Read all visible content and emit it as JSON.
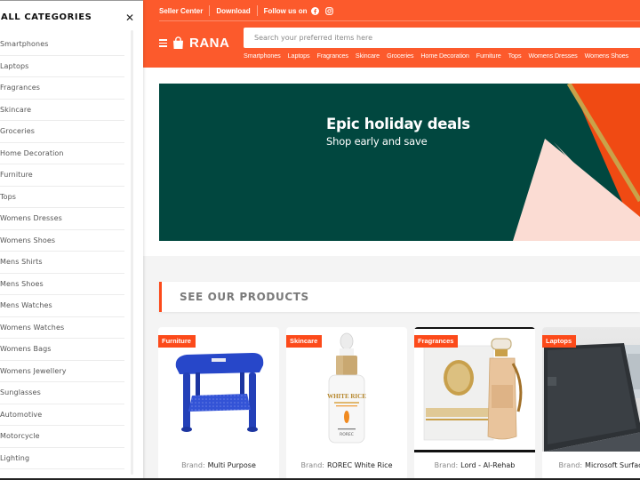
{
  "sidebar": {
    "title": "ALL CATEGORIES",
    "close_icon": "close-icon",
    "categories": [
      "Smartphones",
      "Laptops",
      "Fragrances",
      "Skincare",
      "Groceries",
      "Home Decoration",
      "Furniture",
      "Tops",
      "Womens Dresses",
      "Womens Shoes",
      "Mens Shirts",
      "Mens Shoes",
      "Mens Watches",
      "Womens Watches",
      "Womens Bags",
      "Womens Jewellery",
      "Sunglasses",
      "Automotive",
      "Motorcycle",
      "Lighting"
    ]
  },
  "header": {
    "topbar": {
      "seller_center": "Seller Center",
      "download": "Download",
      "follow_us": "Follow us on",
      "social_icons": [
        "facebook-icon",
        "instagram-icon"
      ]
    },
    "logo": {
      "icon": "shopping-bag-icon",
      "text": "RANA"
    },
    "menu_icon": "hamburger-menu-icon",
    "search": {
      "placeholder": "Search your preferred items here",
      "value": ""
    },
    "nav_links": [
      "Smartphones",
      "Laptops",
      "Fragrances",
      "Skincare",
      "Groceries",
      "Home Decoration",
      "Furniture",
      "Tops",
      "Womens Dresses",
      "Womens Shoes"
    ],
    "colors": {
      "brand": "#fc5a2c",
      "accent": "#fc4a1a"
    }
  },
  "hero": {
    "title": "Epic holiday deals",
    "subtitle": "Shop early and save",
    "colors": {
      "background": "#01473f",
      "orange": "#f04a13",
      "pink": "#fbdcd3",
      "gold": "#c9a24a"
    }
  },
  "products_section": {
    "title": "SEE OUR PRODUCTS",
    "brand_label": "Brand:",
    "items": [
      {
        "category": "Furniture",
        "brand": "Multi Purpose",
        "image": "blue plastic table"
      },
      {
        "category": "Skincare",
        "brand": "ROREC White Rice",
        "image": "white rice serum bottle"
      },
      {
        "category": "Fragrances",
        "brand": "Lord - Al-Rehab",
        "image": "perfume bottle and box"
      },
      {
        "category": "Laptops",
        "brand": "Microsoft Surface",
        "image": "dark laptop"
      }
    ]
  }
}
